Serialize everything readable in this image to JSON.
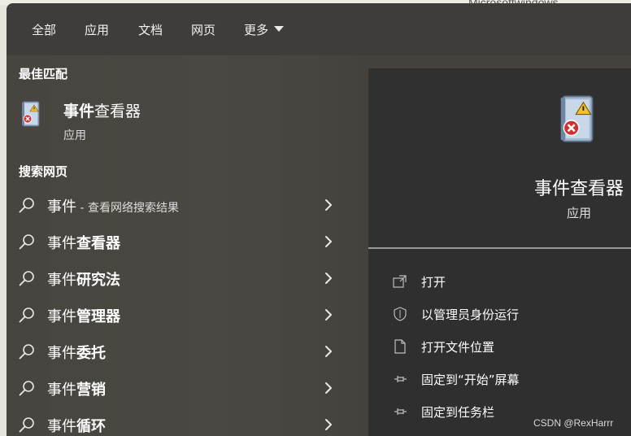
{
  "background": {
    "peek_text": "Microsoftwindows"
  },
  "tabs": [
    {
      "label": "全部"
    },
    {
      "label": "应用"
    },
    {
      "label": "文档"
    },
    {
      "label": "网页"
    },
    {
      "label": "更多"
    }
  ],
  "best_match": {
    "section_title": "最佳匹配",
    "name_bold": "事件",
    "name_rest": "查看器",
    "type": "应用",
    "icon": "event-viewer-icon"
  },
  "web_search": {
    "section_title": "搜索网页",
    "results": [
      {
        "prefix": "事件",
        "bold": "",
        "suffix": " - 查看网络搜索结果"
      },
      {
        "prefix": "事件",
        "bold": "查看器",
        "suffix": ""
      },
      {
        "prefix": "事件",
        "bold": "研究法",
        "suffix": ""
      },
      {
        "prefix": "事件",
        "bold": "管理器",
        "suffix": ""
      },
      {
        "prefix": "事件",
        "bold": "委托",
        "suffix": ""
      },
      {
        "prefix": "事件",
        "bold": "营销",
        "suffix": ""
      },
      {
        "prefix": "事件",
        "bold": "循环",
        "suffix": ""
      }
    ]
  },
  "detail": {
    "name": "事件查看器",
    "type": "应用",
    "actions": [
      {
        "label": "打开",
        "icon": "open-icon"
      },
      {
        "label": "以管理员身份运行",
        "icon": "shield-icon"
      },
      {
        "label": "打开文件位置",
        "icon": "file-location-icon"
      },
      {
        "label": "固定到“开始”屏幕",
        "icon": "pin-icon"
      },
      {
        "label": "固定到任务栏",
        "icon": "pin-icon"
      }
    ]
  },
  "watermark": "CSDN @RexHarrr",
  "colors": {
    "panel": "#45413d",
    "detail": "#303030",
    "text": "#ffffff"
  }
}
